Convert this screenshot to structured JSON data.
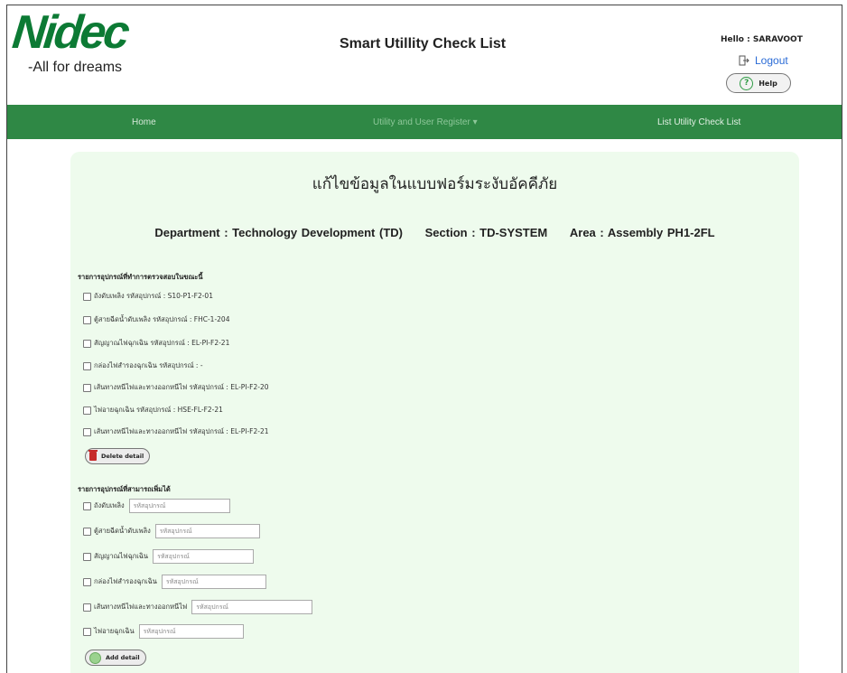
{
  "header": {
    "logo_text": "Nidec",
    "logo_tagline": "-All for dreams",
    "app_title": "Smart Utillity Check List",
    "greeting": "Hello : SARAVOOT",
    "logout_label": "Logout",
    "help_label": "Help"
  },
  "navbar": {
    "home": "Home",
    "register": "Utility and User Register ▾",
    "list": "List Utility Check List"
  },
  "form": {
    "title": "แก้ไขข้อมูลในแบบฟอร์มระงับอัคคีภัย",
    "department": "Department : Technology Development (TD)",
    "section": "Section : TD-SYSTEM",
    "area": "Area : Assembly PH1-2FL",
    "existing_heading": "รายการอุปกรณ์ที่ทำการตรวจสอบในขณะนี้",
    "existing_items": [
      "ถังดับเพลิง รหัสอุปกรณ์ : S10-P1-F2-01",
      "ตู้สายฉีดน้ำดับเพลิง รหัสอุปกรณ์ : FHC-1-204",
      "สัญญาณไฟฉุกเฉิน รหัสอุปกรณ์ : EL-PI-F2-21",
      "กล่องไฟสำรองฉุกเฉิน รหัสอุปกรณ์ : -",
      "เส้นทางหนีไฟและทางออกหนีไฟ รหัสอุปกรณ์ : EL-PI-F2-20",
      "ไฟอายฉุกเฉิน รหัสอุปกรณ์ : HSE-FL-F2-21",
      "เส้นทางหนีไฟและทางออกหนีไฟ รหัสอุปกรณ์ : EL-PI-F2-21"
    ],
    "delete_label": "Delete detail",
    "add_heading": "รายการอุปกรณ์ที่สามารถเพิ่มได้",
    "add_items": [
      "ถังดับเพลิง",
      "ตู้สายฉีดน้ำดับเพลิง",
      "สัญญาณไฟฉุกเฉิน",
      "กล่องไฟสำรองฉุกเฉิน",
      "เส้นทางหนีไฟและทางออกหนีไฟ",
      "ไฟอายฉุกเฉิน"
    ],
    "code_placeholder": "รหัสอุปกรณ์",
    "add_label": "Add detail"
  },
  "colors": {
    "brand_green": "#0c7a34",
    "navbar_green": "#2f8845",
    "card_bg": "#eefbed",
    "link_blue": "#2a6bd6",
    "delete_red": "#c62828"
  }
}
